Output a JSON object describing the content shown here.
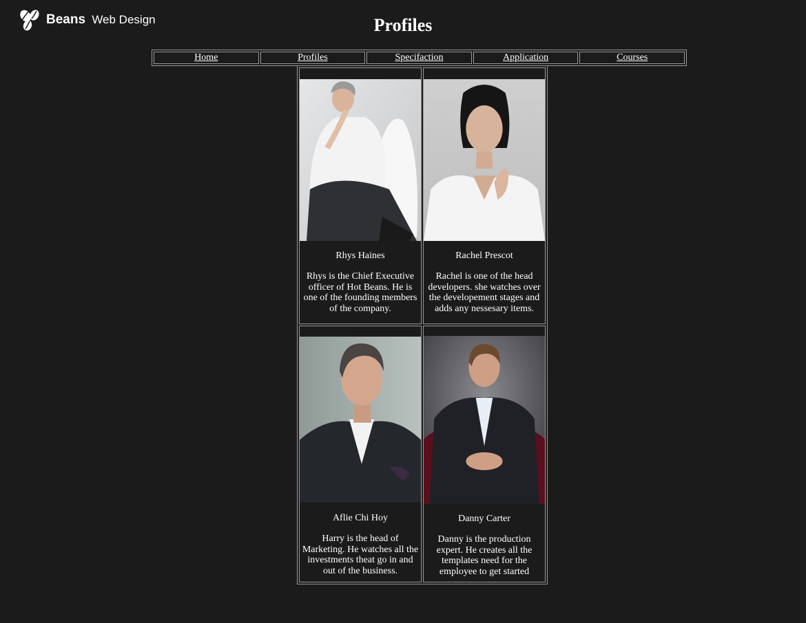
{
  "logo": {
    "brand": "Beans",
    "tagline": "Web Design"
  },
  "page": {
    "title": "Profiles"
  },
  "nav": {
    "items": [
      "Home",
      "Profiles",
      "Specifaction",
      "Application",
      "Courses"
    ]
  },
  "profiles": [
    {
      "name": "Rhys Haines",
      "bio": "Rhys is the Chief Executive officer of Hot Beans. He is one of the founding members of the company.",
      "photo_alt": "portrait-man-grey-hair-white-shirt"
    },
    {
      "name": "Rachel Prescot",
      "bio": "Rachel is one of the head developers. she watches over the developement stages and adds any nessesary items.",
      "photo_alt": "portrait-woman-dark-hair-white-blouse"
    },
    {
      "name": "Aflie Chi Hoy",
      "bio": "Harry is the head of Marketing. He watches all the investments theat go in and out of the business.",
      "photo_alt": "portrait-man-dark-suit"
    },
    {
      "name": "Danny Carter",
      "bio": "Danny is the production expert. He creates all the templates need for the employee to get started",
      "photo_alt": "portrait-man-seated-dark-suit"
    }
  ],
  "colors": {
    "background": "#1b1b1b",
    "text": "#ffffff",
    "border": "#9a9a9a"
  }
}
